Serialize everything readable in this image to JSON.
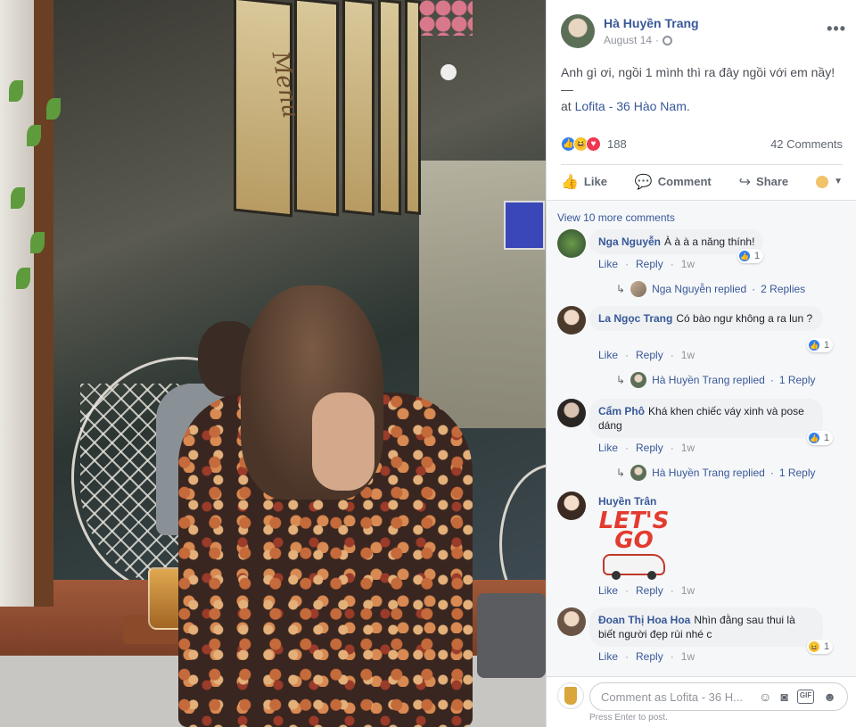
{
  "post": {
    "author": "Hà Huyền Trang",
    "date": "August 14",
    "text": "Anh gì ơi, ngồi 1 mình thì ra đây ngồi với em nầy! —",
    "at_prefix": "at",
    "location": "Lofita - 36 Hào Nam",
    "location_suffix": ".",
    "reaction_count": "188",
    "comment_count": "42 Comments"
  },
  "actions": {
    "like": "Like",
    "comment": "Comment",
    "share": "Share"
  },
  "comments": {
    "view_more": "View 10 more comments",
    "items": [
      {
        "name": "Nga Nguyễn",
        "text": "À à à a năng thính!",
        "reactions": "1",
        "like": "Like",
        "reply": "Reply",
        "time": "1w",
        "replied_by": "Nga Nguyễn replied",
        "replies": "2 Replies"
      },
      {
        "name": "La Ngọc Trang",
        "text": "Có bào ngư không a ra lun ?",
        "reactions": "1",
        "like": "Like",
        "reply": "Reply",
        "time": "1w",
        "replied_by": "Hà Huyền Trang replied",
        "replies": "1 Reply"
      },
      {
        "name": "Cẩm Phô",
        "text": "Khá khen chiếc váy xinh và pose dáng",
        "reactions": "1",
        "like": "Like",
        "reply": "Reply",
        "time": "1w",
        "replied_by": "Hà Huyền Trang replied",
        "replies": "1 Reply"
      },
      {
        "name": "Huyền Trân",
        "sticker_line1": "LET'S",
        "sticker_line2": "GO",
        "like": "Like",
        "reply": "Reply",
        "time": "1w"
      },
      {
        "name": "Đoan Thị Hoa Hoa",
        "text": "Nhìn đằng sau thui là biết người đẹp rùi nhé c",
        "reactions": "1",
        "like": "Like",
        "reply": "Reply",
        "time": "1w"
      }
    ]
  },
  "composer": {
    "placeholder": "Comment as Lofita - 36 H...",
    "hint": "Press Enter to post."
  },
  "photo": {
    "menu_sign": "Menu"
  },
  "icons": {
    "more": "more-dots-icon",
    "globe": "globe-icon",
    "like": "thumbs-up-icon",
    "comment": "speech-bubble-icon",
    "share": "share-arrow-icon",
    "emoji": "emoji-icon",
    "camera": "camera-icon",
    "gif": "gif-icon",
    "sticker": "sticker-icon"
  },
  "colors": {
    "link": "#385898",
    "like_blue": "#2f7ef4",
    "love_red": "#f0374f",
    "haha_yellow": "#f7c236"
  }
}
